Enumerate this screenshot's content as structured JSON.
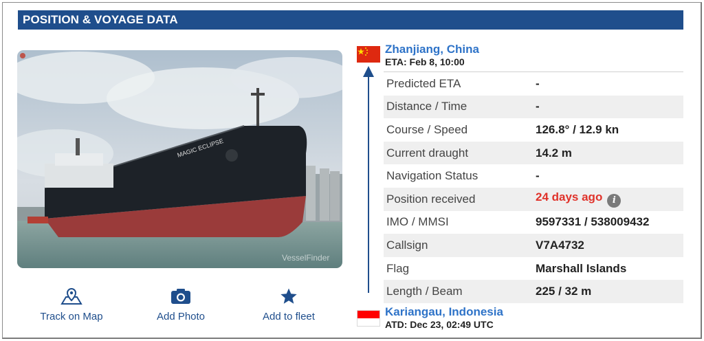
{
  "header": {
    "title": "POSITION & VOYAGE DATA"
  },
  "photo": {
    "ship_name_on_hull": "MAGIC ECLIPSE",
    "watermark": "VesselFinder"
  },
  "actions": [
    {
      "label": "Track on Map",
      "icon": "map-pin-icon"
    },
    {
      "label": "Add Photo",
      "icon": "camera-icon"
    },
    {
      "label": "Add to fleet",
      "icon": "star-icon"
    }
  ],
  "destination": {
    "port": "Zhanjiang, China",
    "eta": "ETA: Feb 8, 10:00",
    "flag": "china-flag",
    "flag_color": "#de2910"
  },
  "origin": {
    "port": "Kariangau, Indonesia",
    "atd": "ATD: Dec 23, 02:49 UTC",
    "flag": "indonesia-flag",
    "flag_color": "#ff0000"
  },
  "details": [
    {
      "label": "Predicted ETA",
      "value": "-"
    },
    {
      "label": "Distance / Time",
      "value": "-"
    },
    {
      "label": "Course / Speed",
      "value": "126.8° / 12.9 kn"
    },
    {
      "label": "Current draught",
      "value": "14.2 m"
    },
    {
      "label": "Navigation Status",
      "value": "-"
    },
    {
      "label": "Position received",
      "value": "24 days ago",
      "status_color": "#e0322a",
      "icon": "info-icon"
    },
    {
      "label": "IMO / MMSI",
      "value": "9597331 / 538009432"
    },
    {
      "label": "Callsign",
      "value": "V7A4732"
    },
    {
      "label": "Flag",
      "value": "Marshall Islands"
    },
    {
      "label": "Length / Beam",
      "value": "225 / 32 m"
    }
  ],
  "colors": {
    "header_bg": "#1f4e8c",
    "link": "#2e73c8",
    "accent": "#1f4e8c",
    "alert": "#e0322a"
  }
}
